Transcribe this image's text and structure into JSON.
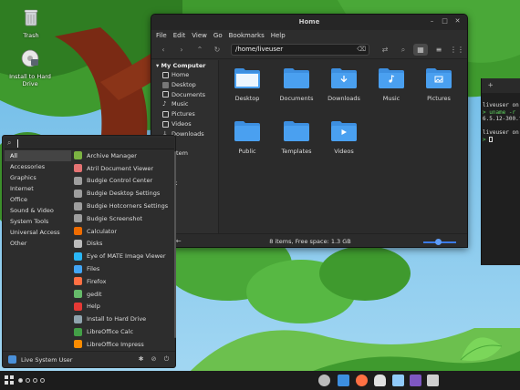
{
  "desktop": {
    "icons": [
      {
        "label": "Trash"
      },
      {
        "label": "Install to Hard Drive"
      }
    ]
  },
  "files_window": {
    "title": "Home",
    "menu": [
      "File",
      "Edit",
      "View",
      "Go",
      "Bookmarks",
      "Help"
    ],
    "path": "/home/liveuser",
    "sidebar_header": "My Computer",
    "sidebar_items": [
      {
        "label": "Home",
        "icon": "home-icon"
      },
      {
        "label": "Desktop",
        "icon": "desktop-icon"
      },
      {
        "label": "Documents",
        "icon": "documents-icon"
      },
      {
        "label": "Music",
        "icon": "music-icon"
      },
      {
        "label": "Pictures",
        "icon": "pictures-icon"
      },
      {
        "label": "Videos",
        "icon": "videos-icon"
      },
      {
        "label": "Downloads",
        "icon": "downloads-icon"
      },
      {
        "label": "ecent",
        "icon": "recent-icon"
      },
      {
        "label": "ile System",
        "icon": "drive-icon"
      },
      {
        "label": "rash",
        "icon": "trash-icon"
      },
      {
        "label": "work",
        "icon": "network-icon"
      },
      {
        "label": "etwork",
        "icon": "network-icon"
      }
    ],
    "folders": [
      {
        "label": "Desktop",
        "emblem": ""
      },
      {
        "label": "Documents",
        "emblem": ""
      },
      {
        "label": "Downloads",
        "emblem": "arrow"
      },
      {
        "label": "Music",
        "emblem": "note"
      },
      {
        "label": "Pictures",
        "emblem": "image"
      },
      {
        "label": "Public",
        "emblem": ""
      },
      {
        "label": "Templates",
        "emblem": ""
      },
      {
        "label": "Videos",
        "emblem": "film"
      }
    ],
    "status": "8 items, Free space: 1.3 GB",
    "zoom_level": 0.45
  },
  "terminal": {
    "tab_plus": "+",
    "lines": [
      "liveuser on",
      "> uname -r",
      "6.5.12-300.f",
      "",
      "liveuser on",
      ">"
    ]
  },
  "menu": {
    "categories": [
      "All",
      "Accessories",
      "Graphics",
      "Internet",
      "Office",
      "Sound & Video",
      "System Tools",
      "Universal Access",
      "Other"
    ],
    "selected_category": "All",
    "apps": [
      {
        "label": "Archive Manager",
        "color": "#7cb342"
      },
      {
        "label": "Atril Document Viewer",
        "color": "#e57373"
      },
      {
        "label": "Budgie Control Center",
        "color": "#9e9e9e"
      },
      {
        "label": "Budgie Desktop Settings",
        "color": "#9e9e9e"
      },
      {
        "label": "Budgie Hotcorners Settings",
        "color": "#9e9e9e"
      },
      {
        "label": "Budgie Screenshot",
        "color": "#9e9e9e"
      },
      {
        "label": "Calculator",
        "color": "#ef6c00"
      },
      {
        "label": "Disks",
        "color": "#bdbdbd"
      },
      {
        "label": "Eye of MATE Image Viewer",
        "color": "#29b6f6"
      },
      {
        "label": "Files",
        "color": "#42a5f5"
      },
      {
        "label": "Firefox",
        "color": "#ff7043"
      },
      {
        "label": "gedit",
        "color": "#66bb6a"
      },
      {
        "label": "Help",
        "color": "#e53935"
      },
      {
        "label": "Install to Hard Drive",
        "color": "#90a4ae"
      },
      {
        "label": "LibreOffice Calc",
        "color": "#43a047"
      },
      {
        "label": "LibreOffice Impress",
        "color": "#fb8c00"
      }
    ],
    "user": "Live System User"
  },
  "colors": {
    "accent": "#3b7be8",
    "folder_blue": "#3d8fe0",
    "panel_bg": "#1c1c1c"
  }
}
